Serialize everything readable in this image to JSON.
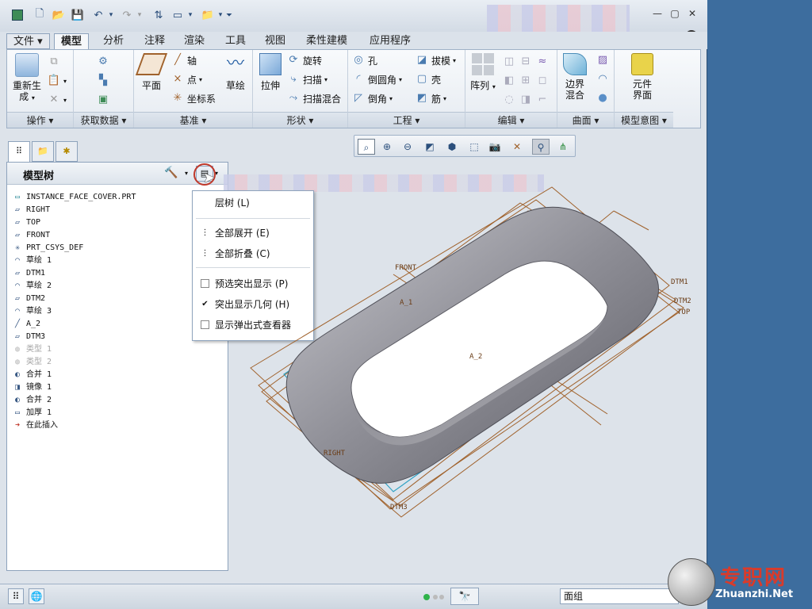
{
  "tabs": [
    "文件",
    "模型",
    "分析",
    "注释",
    "渲染",
    "工具",
    "视图",
    "柔性建模",
    "应用程序"
  ],
  "ribbon": {
    "operations": {
      "regen": "重新生\n成",
      "label": "操作"
    },
    "getdata": {
      "label": "获取数据"
    },
    "datum": {
      "plane": "平面",
      "axis": "轴",
      "point": "点",
      "csys": "坐标系",
      "sketch": "草绘",
      "label": "基准"
    },
    "shapes": {
      "extrude": "拉伸",
      "revolve": "旋转",
      "sweep": "扫描",
      "sweep_blend": "扫描混合",
      "label": "形状"
    },
    "engineering": {
      "hole": "孔",
      "round": "倒圆角",
      "chamfer": "倒角",
      "draft": "拔模",
      "shell": "壳",
      "rib": "筋",
      "label": "工程"
    },
    "editing": {
      "pattern": "阵列",
      "label": "编辑"
    },
    "surfaces": {
      "boundary_blend": "边界\n混合",
      "label": "曲面"
    },
    "model_intent": {
      "component_interface": "元件\n界面",
      "label": "模型意图"
    }
  },
  "model_tree": {
    "title": "模型树",
    "items": [
      {
        "icon": "part-icon",
        "label": "INSTANCE_FACE_COVER.PRT",
        "dim": false
      },
      {
        "icon": "datum-plane-icon",
        "label": "RIGHT",
        "dim": false
      },
      {
        "icon": "datum-plane-icon",
        "label": "TOP",
        "dim": false
      },
      {
        "icon": "datum-plane-icon",
        "label": "FRONT",
        "dim": false
      },
      {
        "icon": "csys-icon",
        "label": "PRT_CSYS_DEF",
        "dim": false
      },
      {
        "icon": "sketch-icon",
        "label": "草绘 1",
        "dim": false
      },
      {
        "icon": "datum-plane-icon",
        "label": "DTM1",
        "dim": false
      },
      {
        "icon": "sketch-icon",
        "label": "草绘 2",
        "dim": false
      },
      {
        "icon": "datum-plane-icon",
        "label": "DTM2",
        "dim": false
      },
      {
        "icon": "sketch-icon",
        "label": "草绘 3",
        "dim": false
      },
      {
        "icon": "axis-icon",
        "label": "A_2",
        "dim": false
      },
      {
        "icon": "datum-plane-icon",
        "label": "DTM3",
        "dim": false
      },
      {
        "icon": "type-icon",
        "label": "类型 1",
        "dim": true
      },
      {
        "icon": "type-icon",
        "label": "类型 2",
        "dim": true
      },
      {
        "icon": "merge-icon",
        "label": "合并 1",
        "dim": false
      },
      {
        "icon": "mirror-icon",
        "label": "镜像 1",
        "dim": false
      },
      {
        "icon": "merge-icon",
        "label": "合并 2",
        "dim": false
      },
      {
        "icon": "thicken-icon",
        "label": "加厚 1",
        "dim": false
      },
      {
        "icon": "insert-arrow-icon",
        "label": "在此插入",
        "dim": false
      }
    ]
  },
  "tree_menu": {
    "layer_tree": "层树 (L)",
    "expand_all": "全部展开 (E)",
    "collapse_all": "全部折叠 (C)",
    "preselect_highlight": {
      "label": "预选突出显示 (P)",
      "checked": false
    },
    "highlight_geometry": {
      "label": "突出显示几何 (H)",
      "checked": true
    },
    "popup_viewer": {
      "label": "显示弹出式查看器",
      "checked": false
    }
  },
  "graphics_labels": {
    "front": "FRONT",
    "dtm1": "DTM1",
    "dtm2": "DTM2",
    "top": "TOP",
    "dtm3": "DTM3",
    "a1": "A_1",
    "a2": "A_2",
    "right": "RIGHT"
  },
  "status_bar": {
    "filter": "面组"
  },
  "watermark": {
    "title": "专职网",
    "site": "Zhuanzhi.Net"
  },
  "colors": {
    "datum": "#a0622c",
    "axis": "#2fa2c4",
    "body": "#8e8e96",
    "accent": "#c0392b"
  }
}
